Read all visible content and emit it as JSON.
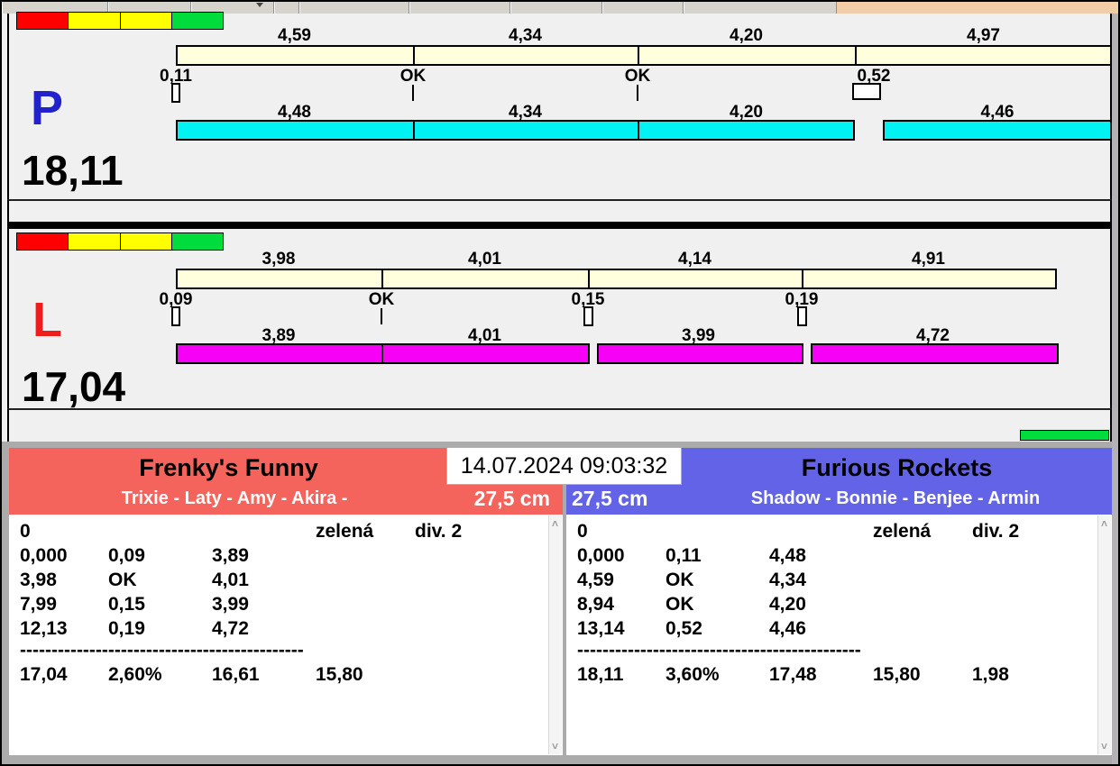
{
  "colors": {
    "bg": "#F0F0F0",
    "toolbar": "#D6D2CC",
    "tan": "#F2CBA7",
    "cream": "#FFFFDE",
    "cyan": "#00F2F2",
    "magenta": "#F600F6",
    "red": "#FF0000",
    "yellow": "#FFFF00",
    "green": "#00DC3C",
    "p-blue": "#2222CC",
    "l-red": "#EE1C1C",
    "team-red": "#F4645C",
    "team-blue": "#6363E8"
  },
  "datetime": "14.07.2024 09:03:32",
  "icons": {
    "scroll_up": "˄",
    "scroll_down": "˅"
  },
  "panels": [
    {
      "letter": "P",
      "total": "18,11",
      "top_segments": [
        {
          "value": "4,59"
        },
        {
          "value": "4,34"
        },
        {
          "value": "4,20"
        },
        {
          "value": "4,97"
        }
      ],
      "markers": [
        {
          "label": "0,11",
          "type": "box"
        },
        {
          "label": "OK",
          "type": "tick"
        },
        {
          "label": "OK",
          "type": "tick"
        },
        {
          "label": "0,52",
          "type": "box-wide"
        }
      ],
      "bottom_segments": [
        {
          "value": "4,48"
        },
        {
          "value": "4,34"
        },
        {
          "value": "4,20"
        },
        {
          "value": "4,46"
        }
      ]
    },
    {
      "letter": "L",
      "total": "17,04",
      "top_segments": [
        {
          "value": "3,98"
        },
        {
          "value": "4,01"
        },
        {
          "value": "4,14"
        },
        {
          "value": "4,91"
        }
      ],
      "markers": [
        {
          "label": "0,09",
          "type": "box"
        },
        {
          "label": "OK",
          "type": "tick"
        },
        {
          "label": "0,15",
          "type": "box"
        },
        {
          "label": "0,19",
          "type": "box"
        }
      ],
      "bottom_segments": [
        {
          "value": "3,89"
        },
        {
          "value": "4,01"
        },
        {
          "value": "3,99"
        },
        {
          "value": "4,72"
        }
      ]
    }
  ],
  "teams": [
    {
      "name": "Frenky's Funny",
      "dogs": "Trixie - Laty - Amy - Akira -",
      "height": "27,5 cm",
      "rows": [
        [
          "0",
          "",
          "",
          "zelená",
          "div. 2"
        ],
        [
          "0,000",
          "0,09",
          "3,89",
          "",
          ""
        ],
        [
          "3,98",
          "OK",
          "4,01",
          "",
          ""
        ],
        [
          "7,99",
          "0,15",
          "3,99",
          "",
          ""
        ],
        [
          "12,13",
          "0,19",
          "4,72",
          "",
          ""
        ]
      ],
      "separator": "---------------------------------------------",
      "totals": [
        "17,04",
        "2,60%",
        "16,61",
        "15,80",
        ""
      ]
    },
    {
      "name": "Furious Rockets",
      "dogs": "Shadow - Bonnie - Benjee - Armin",
      "height": "27,5 cm",
      "rows": [
        [
          "0",
          "",
          "",
          "zelená",
          "div. 2"
        ],
        [
          "0,000",
          "0,11",
          "4,48",
          "",
          ""
        ],
        [
          "4,59",
          "OK",
          "4,34",
          "",
          ""
        ],
        [
          "8,94",
          "OK",
          "4,20",
          "",
          ""
        ],
        [
          "13,14",
          "0,52",
          "4,46",
          "",
          ""
        ]
      ],
      "separator": "---------------------------------------------",
      "totals": [
        "18,11",
        "3,60%",
        "17,48",
        "15,80",
        "1,98"
      ]
    }
  ]
}
